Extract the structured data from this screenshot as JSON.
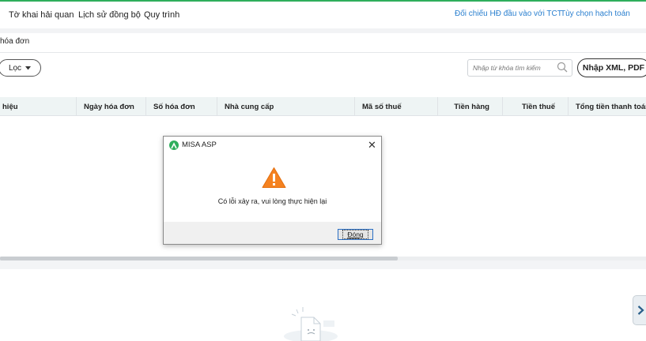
{
  "topnav": {
    "items": [
      "Tờ khai hải quan",
      "Lịch sử đồng bộ",
      "Quy trình"
    ],
    "right_links": [
      "Đối chiếu HĐ đầu vào với TCT",
      "Tùy chọn hạch toán"
    ]
  },
  "breadcrumb": "hóa đơn",
  "toolbar": {
    "filter_label": "Lọc",
    "search_placeholder": "Nhập từ khóa tìm kiếm",
    "import_label": "Nhập XML, PDF"
  },
  "table": {
    "headers": [
      "hiệu",
      "Ngày hóa đơn",
      "Số hóa đơn",
      "Nhà cung cấp",
      "Mã số thuế",
      "Tiền hàng",
      "Tiền thuế",
      "Tổng tiền thanh toán"
    ]
  },
  "dialog": {
    "title": "MISA ASP",
    "message": "Có lỗi xảy ra, vui lòng thực hiện lại",
    "ok_label": "Đóng"
  },
  "colors": {
    "brand_green": "#2eae5c",
    "link_blue": "#2a7fcf",
    "warning_orange": "#f58220"
  },
  "icons": {
    "search": "search-icon",
    "close": "close-icon",
    "warning": "warning-icon",
    "chevron_right": "chevron-right-icon",
    "caret_down": "caret-down-icon"
  }
}
